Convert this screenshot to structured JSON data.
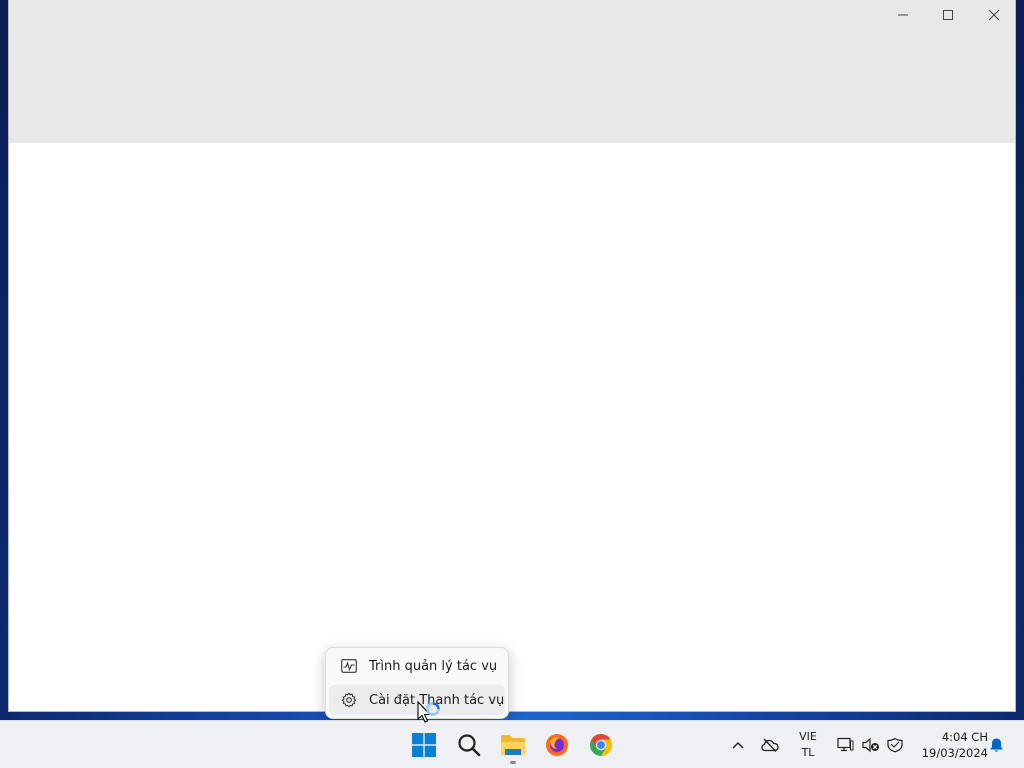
{
  "desktop": {},
  "window": {
    "controls": {
      "minimize_icon": "minimize-icon",
      "maximize_icon": "maximize-icon",
      "close_icon": "close-icon"
    }
  },
  "context_menu": {
    "items": [
      {
        "label": "Trình quản lý tác vụ",
        "icon": "task-manager-icon"
      },
      {
        "label": "Cài đặt Thanh tác vụ",
        "icon": "gear-icon"
      }
    ]
  },
  "taskbar": {
    "apps": [
      {
        "name": "start",
        "icon": "windows-start-icon"
      },
      {
        "name": "search",
        "icon": "search-icon"
      },
      {
        "name": "file-explorer",
        "icon": "folder-icon",
        "running": true
      },
      {
        "name": "firefox",
        "icon": "firefox-icon"
      },
      {
        "name": "chrome",
        "icon": "chrome-icon"
      }
    ],
    "tray": {
      "language_line1": "VIE",
      "language_line2": "TL",
      "time": "4:04 CH",
      "date": "19/03/2024"
    }
  },
  "colors": {
    "accent": "#0067c0",
    "window_titlebar": "#e8e8e8",
    "taskbar_bg": "#eef0f3"
  }
}
